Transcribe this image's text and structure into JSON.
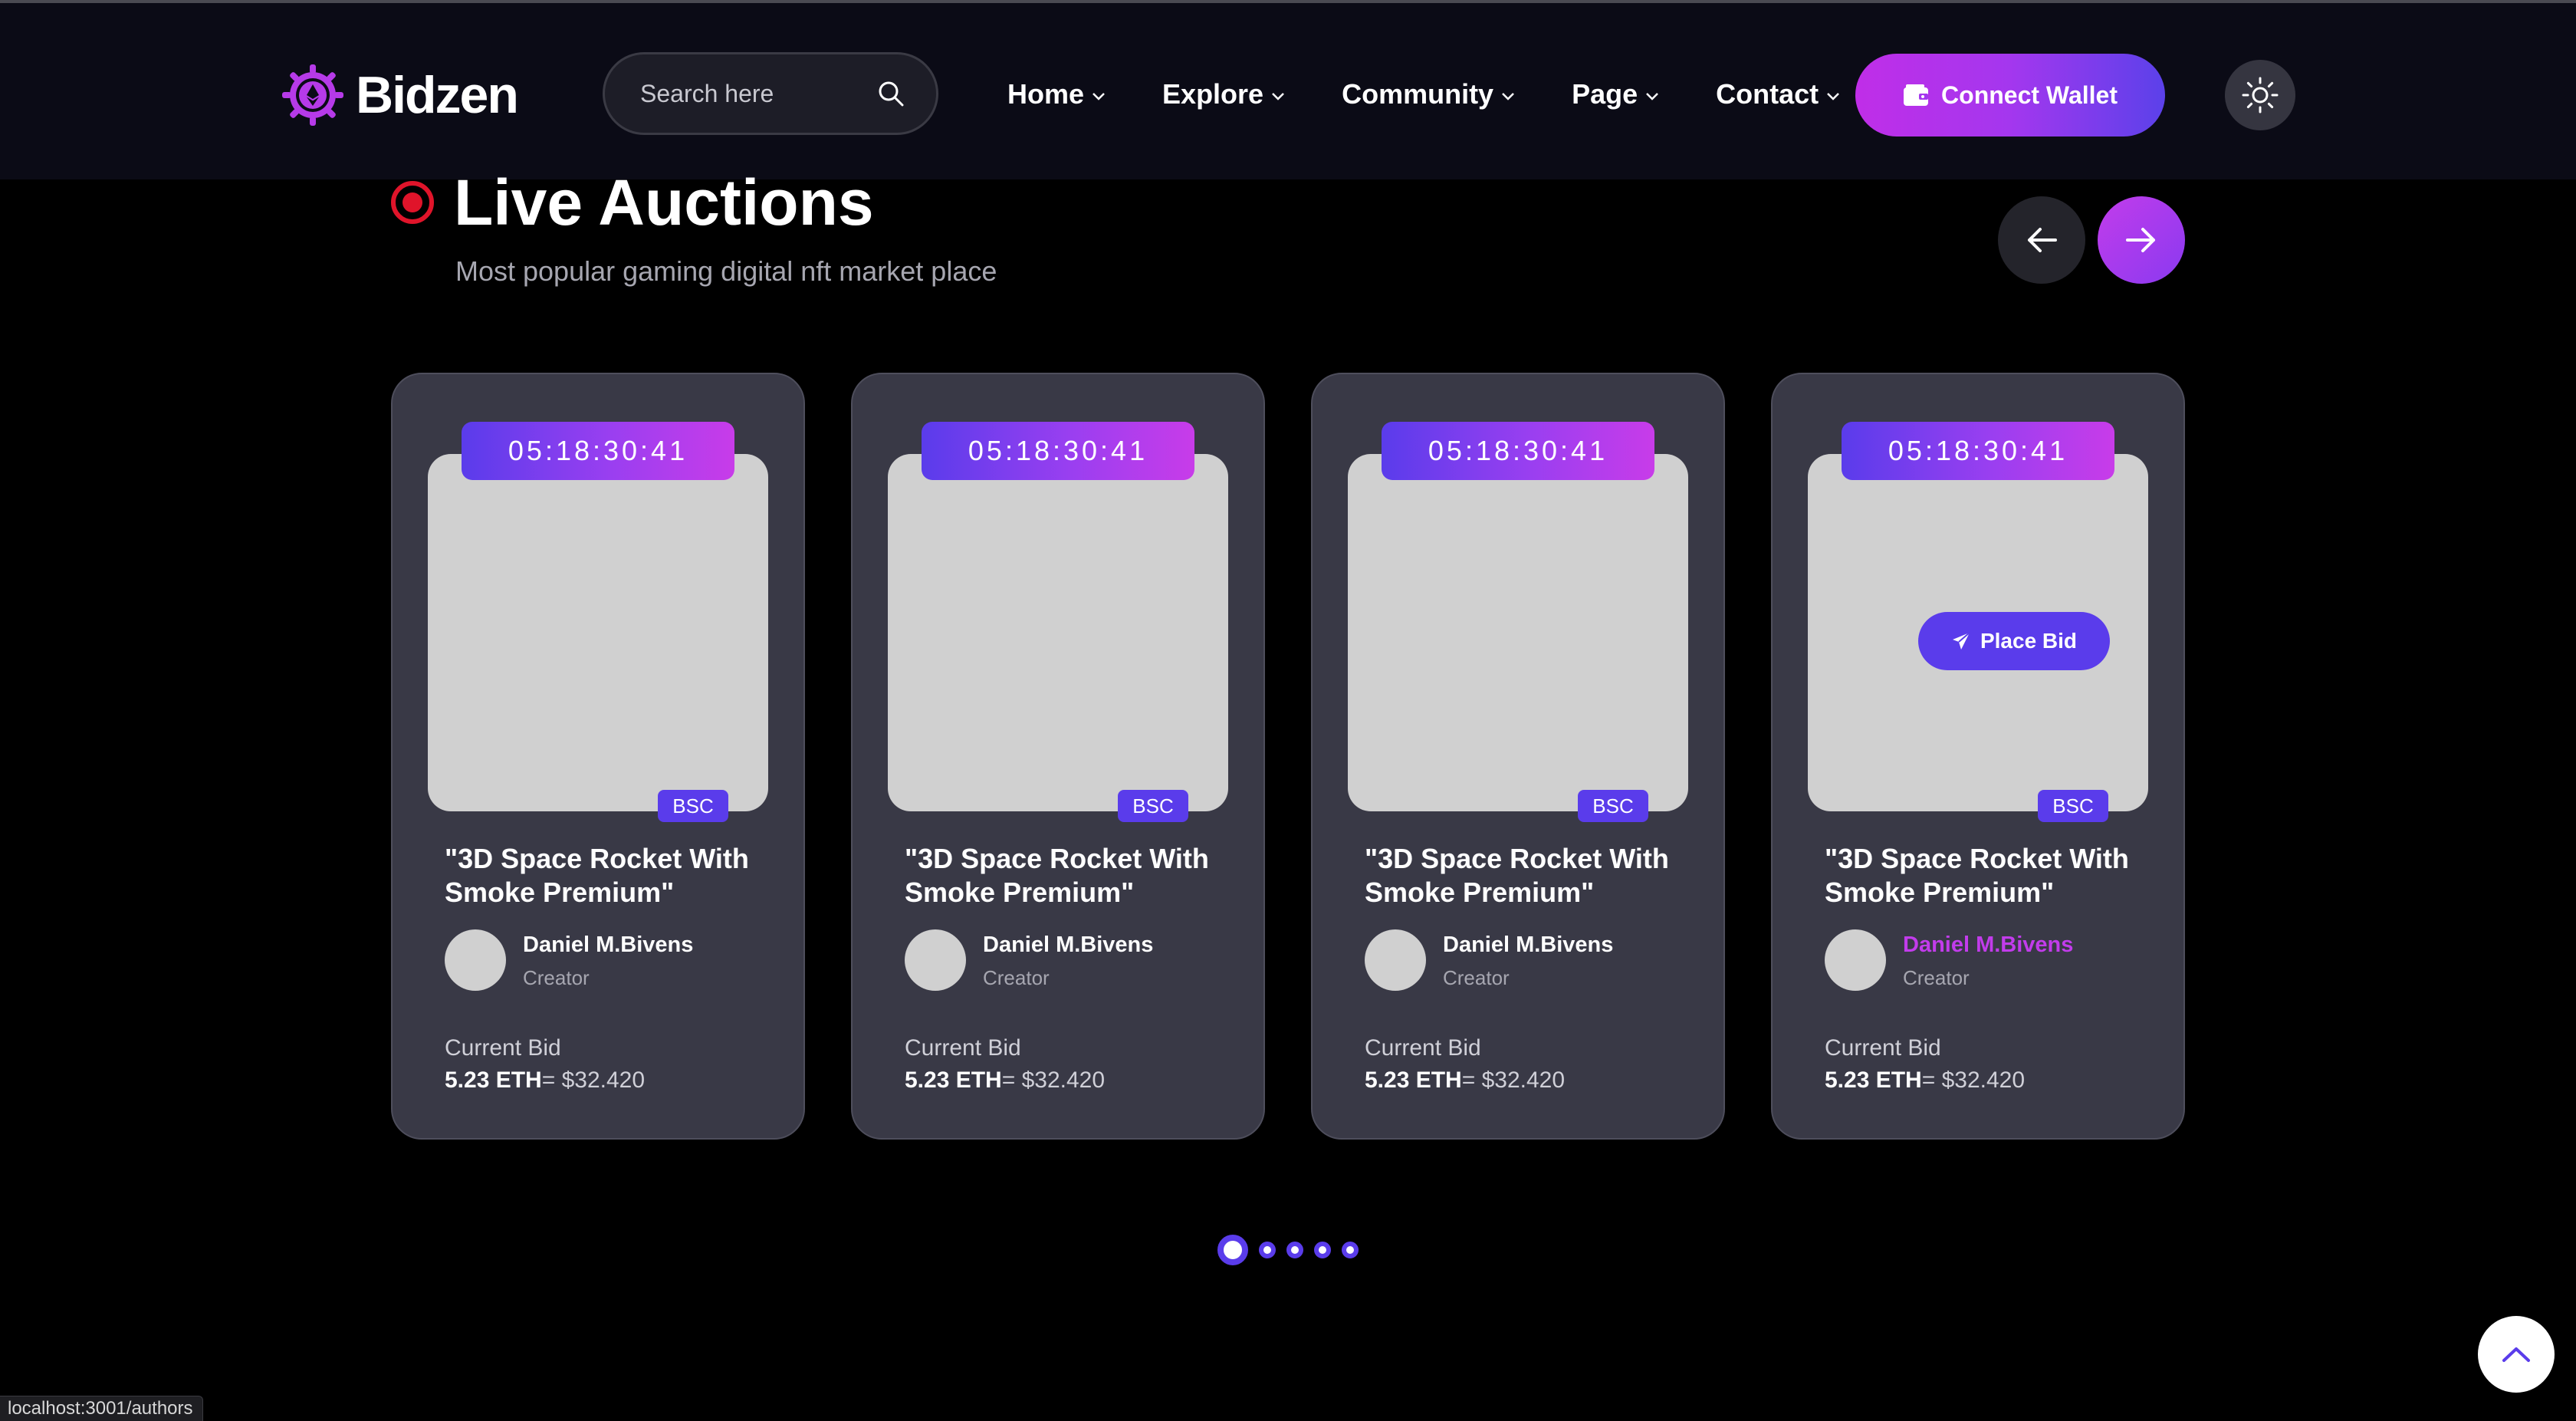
{
  "brand": {
    "name": "Bidzen",
    "accent": "#c23ceb",
    "accent_alt": "#5a3ceb"
  },
  "search": {
    "placeholder": "Search here"
  },
  "nav": {
    "items": [
      {
        "label": "Home"
      },
      {
        "label": "Explore"
      },
      {
        "label": "Community"
      },
      {
        "label": "Page"
      },
      {
        "label": "Contact"
      }
    ]
  },
  "header": {
    "connect_label": "Connect Wallet",
    "theme_icon": "sun-icon"
  },
  "section": {
    "title": "Live Auctions",
    "subtitle": "Most popular gaming digital nft market place",
    "prev_icon": "arrow-left-icon",
    "next_icon": "arrow-right-icon"
  },
  "cards": [
    {
      "timer": "05:18:30:41",
      "chain": "BSC",
      "title": "\"3D Space Rocket With Smoke Premium\"",
      "creator": "Daniel M.Bivens",
      "role": "Creator",
      "bid_label": "Current Bid",
      "bid_eth": "5.23 ETH",
      "bid_usd": "= $32.420"
    },
    {
      "timer": "05:18:30:41",
      "chain": "BSC",
      "title": "\"3D Space Rocket With Smoke Premium\"",
      "creator": "Daniel M.Bivens",
      "role": "Creator",
      "bid_label": "Current Bid",
      "bid_eth": "5.23 ETH",
      "bid_usd": "= $32.420"
    },
    {
      "timer": "05:18:30:41",
      "chain": "BSC",
      "title": "\"3D Space Rocket With Smoke Premium\"",
      "creator": "Daniel M.Bivens",
      "role": "Creator",
      "bid_label": "Current Bid",
      "bid_eth": "5.23 ETH",
      "bid_usd": "= $32.420"
    },
    {
      "timer": "05:18:30:41",
      "chain": "BSC",
      "title": "\"3D Space Rocket With Smoke Premium\"",
      "creator": "Daniel M.Bivens",
      "role": "Creator",
      "bid_label": "Current Bid",
      "bid_eth": "5.23 ETH",
      "bid_usd": "= $32.420",
      "place_bid_label": "Place Bid"
    }
  ],
  "pagination": {
    "total": 5,
    "active": 1
  },
  "status_url": "localhost:3001/authors"
}
